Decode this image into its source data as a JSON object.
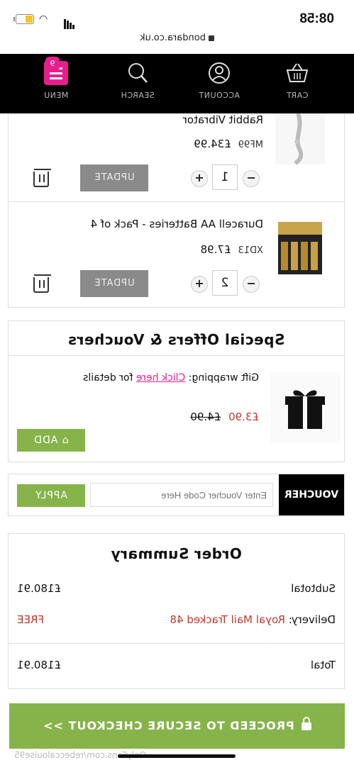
{
  "status": {
    "time": "08:58",
    "url": "bondara.co.uk"
  },
  "nav": {
    "menu": "MENU",
    "search": "SEARCH",
    "account": "ACCOUNT",
    "cart": "CART",
    "cart_count": "9"
  },
  "items": [
    {
      "name": "Rabbit Vibrator",
      "code": "MF99",
      "price": "£34.99",
      "qty": "1",
      "update": "UPDATE"
    },
    {
      "name": "Duracell AA Batteries - Pack of 4",
      "code": "XD13",
      "price": "£7.98",
      "qty": "2",
      "update": "UPDATE"
    }
  ],
  "offers": {
    "title": "Special Offers & Vouchers",
    "gift_prefix": "Gift wrapping:",
    "gift_link": "Click here",
    "gift_suffix": "for details",
    "new_price": "£3.90",
    "old_price": "£4.90",
    "add": "ADD"
  },
  "voucher": {
    "label": "VOUCHER",
    "placeholder": "Enter Voucher Code Here",
    "apply": "APPLY"
  },
  "summary": {
    "title": "Order Summary",
    "subtotal_label": "Subtotal",
    "subtotal": "£180.91",
    "delivery_label": "Delivery:",
    "delivery_method": "Royal Mail Tracked 48",
    "delivery_price": "FREE",
    "total_label": "Total",
    "total": "£180.91"
  },
  "checkout": "PROCEED TO SECURE CHECKOUT >>",
  "watermark": "OnlyFans.com/rebeccalouise95",
  "colors": {
    "accent": "#e91e8c",
    "green": "#86b34a",
    "nav_bg": "#000000",
    "price_red": "#c0392b"
  }
}
